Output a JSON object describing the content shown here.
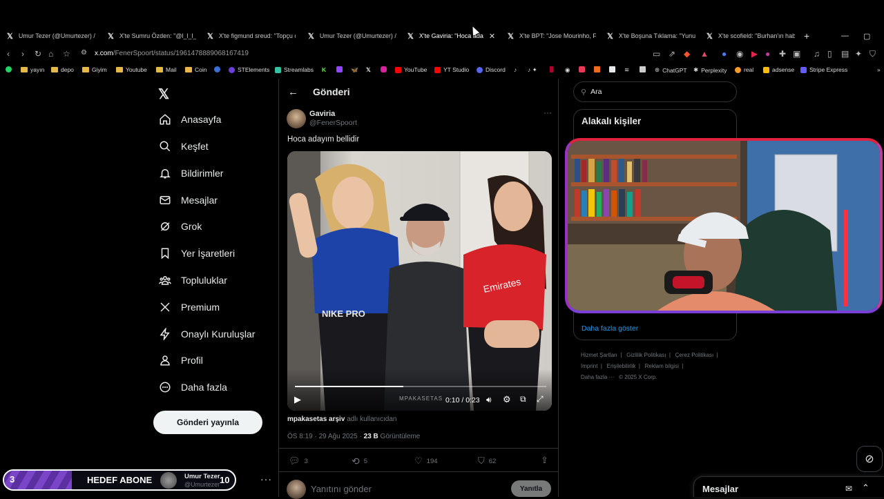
{
  "browser": {
    "tabs": [
      {
        "label": "Umur Tezer (@Umurtezer) / X",
        "active": false
      },
      {
        "label": "X'te Sumru Özden: \"@l_l_l_l\"",
        "active": false
      },
      {
        "label": "X'te figmund sreud: \"Topçu olsa",
        "active": false
      },
      {
        "label": "Umur Tezer (@Umurtezer) / X",
        "active": false
      },
      {
        "label": "X'te Gaviria: \"Hoca adayım",
        "active": true
      },
      {
        "label": "X'te BPT: \"Jose Mourinho, Fene",
        "active": false
      },
      {
        "label": "X'te Boşuna Tıklama: \"Yunus A",
        "active": false
      },
      {
        "label": "X'te scofield: \"Burhan'ın haberi",
        "active": false
      }
    ],
    "url_host": "x.com",
    "url_path": "/FenerSpoort/status/1961478889068167419",
    "bookmarks": [
      "yayın",
      "depo",
      "Giyim",
      "Youtube",
      "Mail",
      "Coin",
      "STElements",
      "Streamlabs",
      "YouTube",
      "YT Studio",
      "Discord",
      "ChatGPT",
      "Perplexity",
      "real",
      "adsense",
      "Stripe Express"
    ]
  },
  "nav": {
    "items": [
      "Anasayfa",
      "Keşfet",
      "Bildirimler",
      "Mesajlar",
      "Grok",
      "Yer İşaretleri",
      "Topluluklar",
      "Premium",
      "Onaylı Kuruluşlar",
      "Profil",
      "Daha fazla"
    ],
    "post_button": "Gönderi yayınla"
  },
  "post": {
    "header_title": "Gönderi",
    "author_name": "Gaviria",
    "author_handle": "@FenerSpoort",
    "text": "Hoca adayım bellidir",
    "video_time": "0:10 / 0:23",
    "video_progress": 0.43,
    "video_watermark": "MPAKASETAS",
    "source_name": "mpakasetas arşiv",
    "source_suffix": "adlı kullanıcıdan",
    "meta_time": "ÖS 8:19 · 29 Ağu 2025 · ",
    "views_count": "23 B",
    "views_label": "Görüntüleme",
    "replies": "3",
    "reposts": "5",
    "likes": "194",
    "bookmarks": "62",
    "reply_placeholder": "Yanıtını gönder",
    "reply_button": "Yanıtla"
  },
  "sidebar": {
    "search_placeholder": "Ara",
    "relevant_title": "Alakalı kişiler",
    "show_more": "Daha fazla göster",
    "footer_links": [
      "Hizmet Şartları",
      "Gizlilik Politikası",
      "Çerez Politikası",
      "Imprint",
      "Erişilebilirlik",
      "Reklam bilgisi",
      "Daha fazla ···",
      "© 2025 X Corp."
    ]
  },
  "overlay": {
    "goal_count": "3",
    "goal_label": "HEDEF ABONE",
    "goal_target": "10",
    "goal_name": "Umur Tezer",
    "goal_handle": "@Umurtezer",
    "messages_label": "Mesajlar"
  }
}
